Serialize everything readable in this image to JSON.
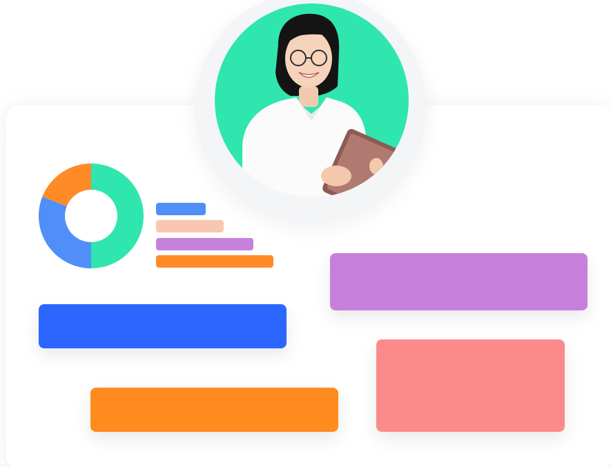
{
  "colors": {
    "background": "#ffffff",
    "card": "#ffffff",
    "halo": "#f4f5f7",
    "avatar_bg": "#2fe6ae",
    "donut_green": "#2fe6ae",
    "donut_blue": "#4f8ff7",
    "donut_orange": "#ff8a28",
    "legend_blue": "#4f8ff7",
    "legend_peach": "#f9c7b1",
    "legend_purple": "#c680dc",
    "legend_orange": "#ff8a28",
    "block_purple": "#c680dc",
    "block_blue": "#2b67ff",
    "block_pink": "#fb8b8b",
    "block_orange": "#ff8a1e"
  },
  "donut": {
    "segments": [
      {
        "color_key": "donut_green",
        "fraction": 0.5
      },
      {
        "color_key": "donut_blue",
        "fraction": 0.31
      },
      {
        "color_key": "donut_orange",
        "fraction": 0.19
      }
    ]
  },
  "avatar": {
    "icon": "person-with-tablet-photo"
  }
}
